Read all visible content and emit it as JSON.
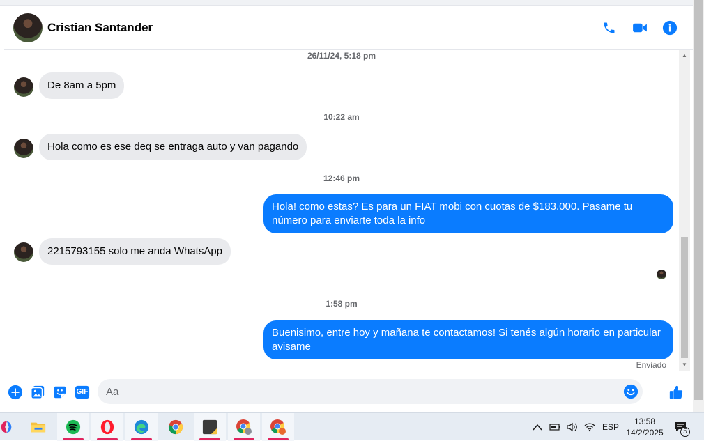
{
  "contact": {
    "name": "Cristian Santander"
  },
  "header_icons": [
    "phone-icon",
    "video-camera-icon",
    "info-icon"
  ],
  "messages": [
    {
      "type": "timestamp",
      "text": "26/11/24, 5:18 pm"
    },
    {
      "type": "incoming",
      "text": "De 8am  a 5pm"
    },
    {
      "type": "timestamp",
      "text": "10:22 am"
    },
    {
      "type": "incoming",
      "text": "Hola como es ese deq se entraga auto y van pagando"
    },
    {
      "type": "timestamp",
      "text": "12:46 pm"
    },
    {
      "type": "outgoing",
      "text": "Hola! como estas? Es para un FIAT mobi con cuotas de $183.000. Pasame tu número para enviarte toda la info"
    },
    {
      "type": "incoming",
      "text": "2215793155 solo me anda WhatsApp"
    },
    {
      "type": "timestamp",
      "text": "1:58 pm"
    },
    {
      "type": "outgoing",
      "text": "Buenisimo, entre hoy y mañana te contactamos! Si tenés algún horario en particular avisame"
    }
  ],
  "status": "Enviado",
  "composer": {
    "placeholder": "Aa",
    "gif_label": "GIF"
  },
  "accent_color": "#0a7cff",
  "taskbar": {
    "apps": [
      "copilot-icon",
      "file-explorer-icon",
      "spotify-icon",
      "opera-icon",
      "edge-icon",
      "chrome-icon",
      "sticky-notes-icon",
      "chrome-profile-icon",
      "chrome-profile-2-icon"
    ],
    "language": "ESP",
    "time": "13:58",
    "date": "14/2/2025",
    "notifications": "5"
  }
}
